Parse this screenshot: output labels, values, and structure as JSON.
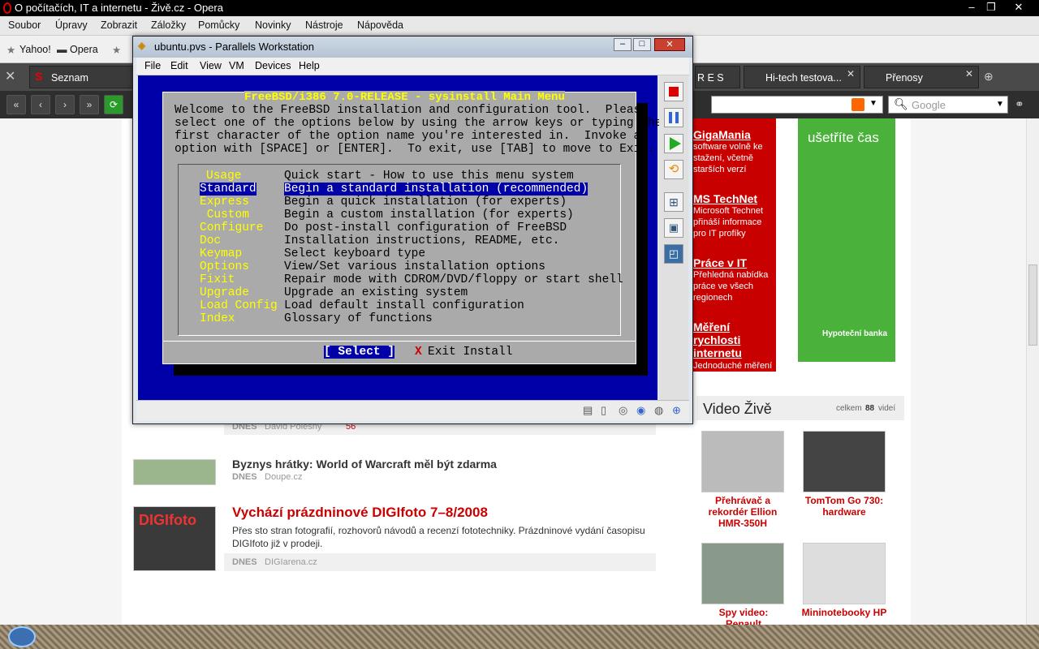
{
  "opera": {
    "title": "O počítačích, IT a internetu - Živě.cz - Opera"
  },
  "menu": [
    "Soubor",
    "Úpravy",
    "Zobrazit",
    "Záložky",
    "Pomůcky",
    "Novinky",
    "Nástroje",
    "Nápověda"
  ],
  "bookmarks": [
    "Yahoo!",
    "Opera"
  ],
  "tabs": [
    {
      "label": "Seznam"
    },
    {
      "label": "R E S"
    },
    {
      "label": "Hi-tech testova..."
    },
    {
      "label": "Přenosy"
    }
  ],
  "search": {
    "placeholder": "Google"
  },
  "parallels": {
    "title": "ubuntu.pvs - Parallels Workstation",
    "menu": [
      "File",
      "Edit",
      "View",
      "VM",
      "Devices",
      "Help"
    ]
  },
  "freebsd": {
    "title": "FreeBSD/i386 7.0-RELEASE - sysinstall Main Menu",
    "intro": "Welcome to the FreeBSD installation and configuration tool.  Please\nselect one of the options below by using the arrow keys or typing the\nfirst character of the option name you're interested in.  Invoke an\noption with [SPACE] or [ENTER].  To exit, use [TAB] to move to Exit.",
    "items": [
      {
        "key": "Usage",
        "desc": "Quick start - How to use this menu system"
      },
      {
        "key": "Standard",
        "desc": "Begin a standard installation (recommended)"
      },
      {
        "key": "Express",
        "desc": "Begin a quick installation (for experts)"
      },
      {
        "key": " Custom",
        "desc": "Begin a custom installation (for experts)"
      },
      {
        "key": "Configure",
        "desc": "Do post-install configuration of FreeBSD"
      },
      {
        "key": "Doc",
        "desc": "Installation instructions, README, etc."
      },
      {
        "key": "Keymap",
        "desc": "Select keyboard type"
      },
      {
        "key": "Options",
        "desc": "View/Set various installation options"
      },
      {
        "key": "Fixit",
        "desc": "Repair mode with CDROM/DVD/floppy or start shell"
      },
      {
        "key": "Upgrade",
        "desc": "Upgrade an existing system"
      },
      {
        "key": "Load Config",
        "desc": "Load default install configuration"
      },
      {
        "key": "Index",
        "desc": "Glossary of functions"
      }
    ],
    "select": "[ Select ]",
    "exit_x": "X",
    "exit": "Exit Install"
  },
  "sidebar": {
    "boxes": [
      {
        "title": "GigaMania",
        "desc": "software volně ke stažení, včetně starších verzí"
      },
      {
        "title": "MS TechNet",
        "desc": "Microsoft Technet přináší informace pro IT profíky"
      },
      {
        "title": "Práce v IT",
        "desc": "Přehledná nabídka práce ve všech regionech"
      },
      {
        "title": "Měření rychlosti internetu",
        "desc": "Jednoduché měření rychlosti připojení k internetu"
      }
    ],
    "ad": {
      "headline": "ušetříte čas",
      "brand": "Hypoteční banka"
    }
  },
  "video": {
    "title": "Video Živě",
    "count_pre": "celkem",
    "count": "88",
    "count_post": "videí",
    "items": [
      "Přehrávač a rekordér Ellion HMR-350H",
      "TomTom Go 730: hardware",
      "Spy video: Renault",
      "Mininotebooky HP"
    ]
  },
  "articles": [
    {
      "title": "",
      "date": "DNES",
      "author": "David Polesný",
      "comments": "56"
    },
    {
      "title": "Byznys hrátky: World of Warcraft měl být zdarma",
      "date": "DNES",
      "author": "Doupe.cz"
    },
    {
      "title": "Vychází prázdninové DIGIfoto 7–8/2008",
      "desc": "Přes sto stran fotografií, rozhovorů návodů a recenzí fototechniky. Prázdninové vydání časopisu DIGIfoto již v prodeji.",
      "date": "DNES",
      "author": "DIGIarena.cz"
    }
  ],
  "thumb_label": "DIGIfoto"
}
